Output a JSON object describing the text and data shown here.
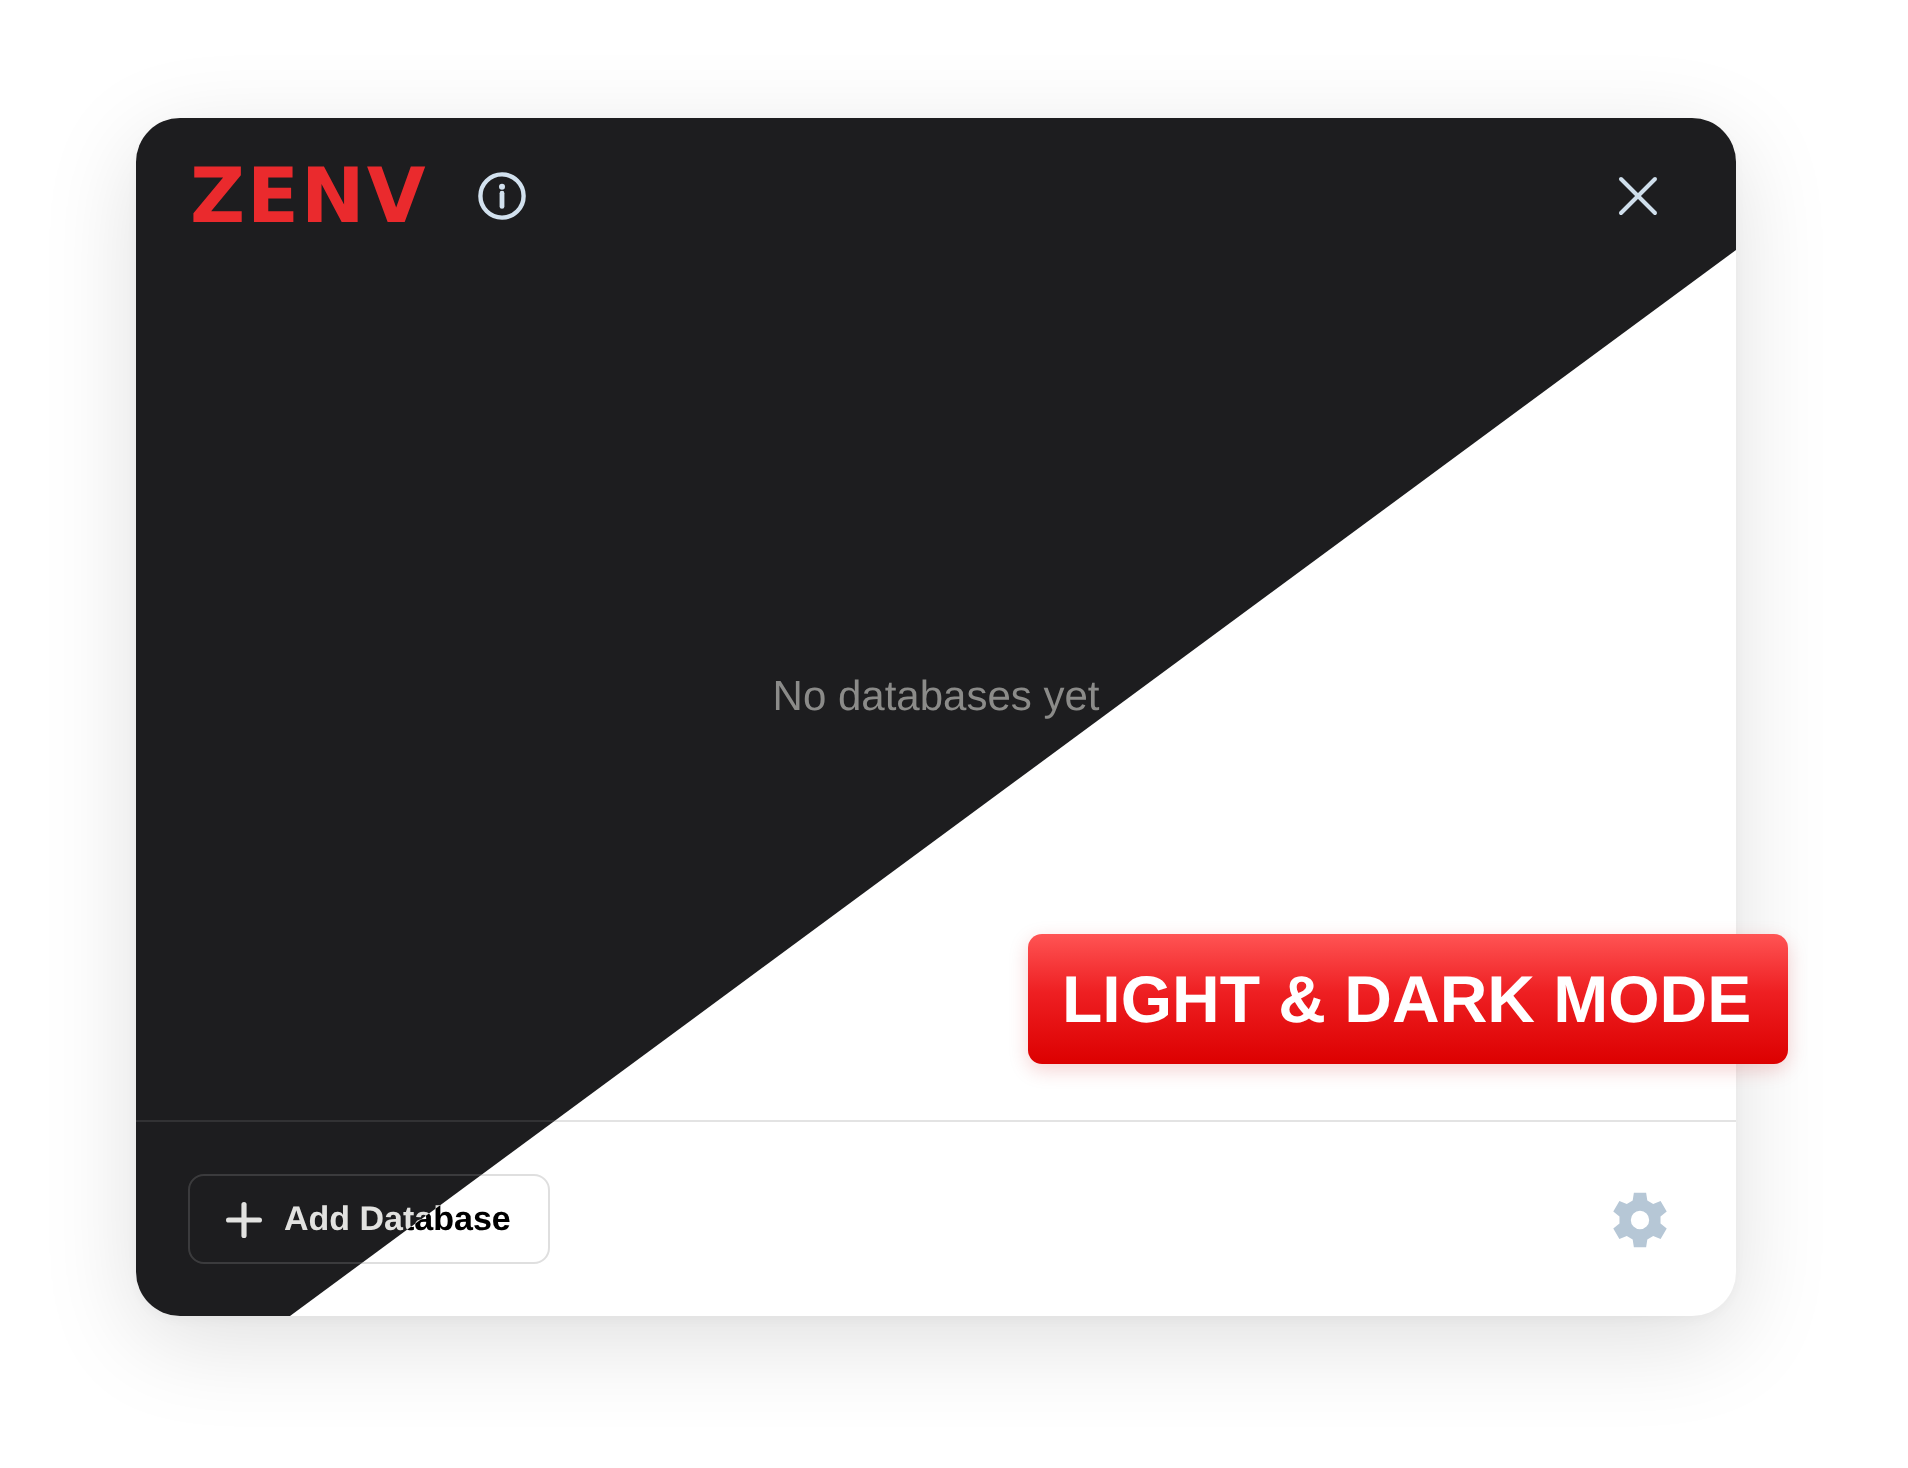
{
  "dark_mode_split": true,
  "header": {
    "logo": "ZENV"
  },
  "empty_state": {
    "message": "No databases yet"
  },
  "footer": {
    "add_button": {
      "label": "Add Database"
    }
  },
  "badge": {
    "label": "LIGHT & DARK MODE"
  }
}
